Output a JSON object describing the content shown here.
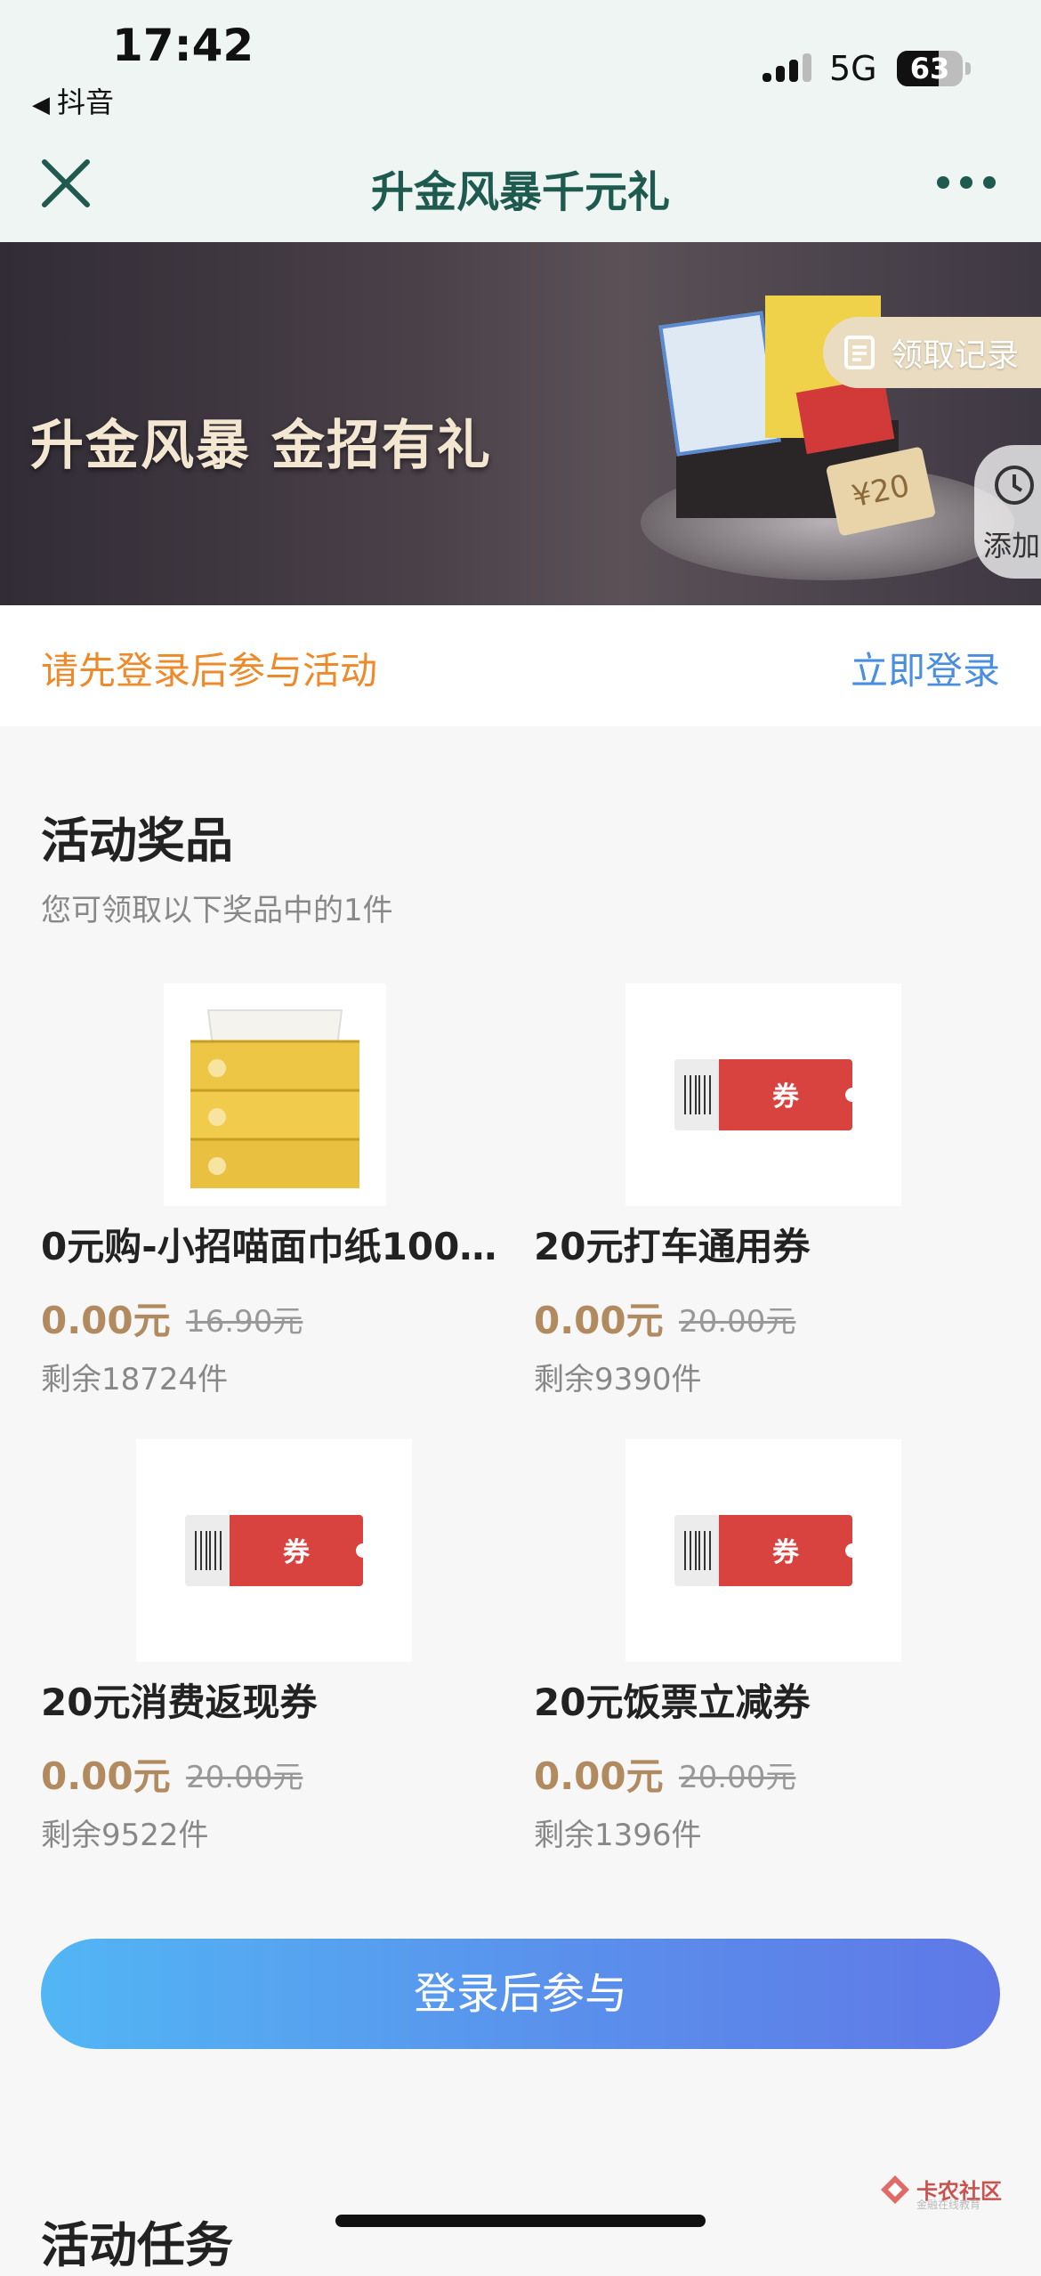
{
  "status_bar": {
    "time": "17:42",
    "back_app": "抖音",
    "network": "5G",
    "battery": "63",
    "battery_level": 0.63
  },
  "nav": {
    "title": "升金风暴千元礼",
    "close_icon": "close-icon",
    "more_icon": "more-icon"
  },
  "banner": {
    "headline": "升金风暴 金招有礼",
    "record_label": "领取记录",
    "add_label": "添加",
    "coupon_value": "¥20"
  },
  "login_bar": {
    "tip": "请先登录后参与活动",
    "action": "立即登录"
  },
  "prizes": {
    "title": "活动奖品",
    "subtitle": "您可领取以下奖品中的1件",
    "items": [
      {
        "name": "0元购-小招喵面巾纸100…",
        "price": "0.00元",
        "original": "16.90元",
        "stock": "剩余18724件",
        "image": "tissue-box"
      },
      {
        "name": "20元打车通用券",
        "price": "0.00元",
        "original": "20.00元",
        "stock": "剩余9390件",
        "image": "coupon-ticket"
      },
      {
        "name": "20元消费返现券",
        "price": "0.00元",
        "original": "20.00元",
        "stock": "剩余9522件",
        "image": "coupon-ticket"
      },
      {
        "name": "20元饭票立减券",
        "price": "0.00元",
        "original": "20.00元",
        "stock": "剩余1396件",
        "image": "coupon-ticket"
      }
    ],
    "ticket_label": "券"
  },
  "cta": {
    "label": "登录后参与"
  },
  "next_section": {
    "title": "活动任务"
  },
  "watermark": {
    "text": "卡农社区",
    "sub": "金融在线教育"
  },
  "colors": {
    "title_green": "#1f5a4f",
    "login_orange": "#ee8a2a",
    "link_blue": "#4a8ee0",
    "price_gold": "#b28a5f",
    "ticket_red": "#d9433f"
  }
}
